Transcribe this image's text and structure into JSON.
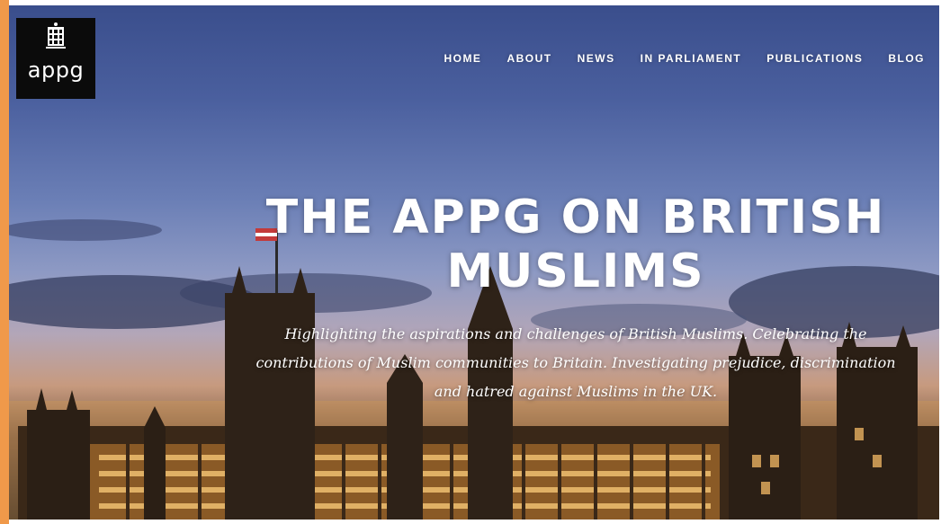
{
  "logo": {
    "text": "appg",
    "icon": "portcullis-icon"
  },
  "nav": {
    "items": [
      {
        "label": "HOME"
      },
      {
        "label": "ABOUT"
      },
      {
        "label": "NEWS"
      },
      {
        "label": "IN PARLIAMENT"
      },
      {
        "label": "PUBLICATIONS"
      },
      {
        "label": "BLOG"
      }
    ]
  },
  "hero": {
    "title_line1": "THE APPG ON BRITISH",
    "title_line2": "MUSLIMS",
    "tagline_line1": "Highlighting the aspirations and challenges of British Muslims. Celebrating the",
    "tagline_line2": "contributions of Muslim communities to Britain. Investigating prejudice, discrimination",
    "tagline_line3": "and hatred against Muslims in the UK.",
    "background": "houses-of-parliament-dusk-photo"
  },
  "colors": {
    "accent": "#f0994a",
    "logo_bg": "#0b0b0b",
    "text": "#ffffff",
    "sky_top": "#3a4e8c"
  }
}
